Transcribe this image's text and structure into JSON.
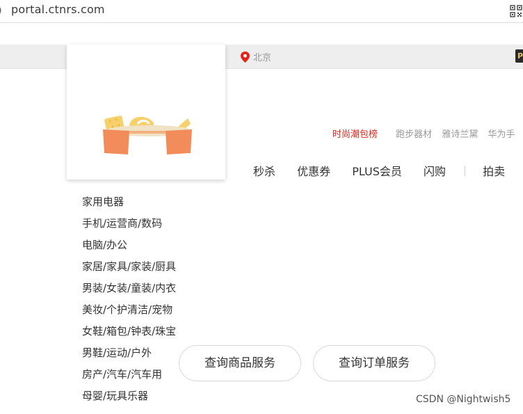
{
  "browser": {
    "url": "portal.ctnrs.com",
    "icons": [
      "page-info-icon",
      "qr-code-icon"
    ]
  },
  "topbar": {
    "location": "北京",
    "location_icon": "location-pin-icon",
    "plus_badge": "P"
  },
  "hot_words": [
    "时尚潮包榜",
    "跑步器材",
    "雅诗兰黛",
    "华为手"
  ],
  "nav_menu": [
    "秒杀",
    "优惠券",
    "PLUS会员",
    "闪购",
    "拍卖"
  ],
  "categories": [
    "家用电器",
    "手机/运营商/数码",
    "电脑/办公",
    "家居/家具/家装/厨具",
    "男装/女装/童装/内衣",
    "美妆/个护清洁/宠物",
    "女鞋/箱包/钟表/珠宝",
    "男鞋/运动/户外",
    "房产/汽车/汽车用",
    "母婴/玩具乐器"
  ],
  "buttons": {
    "query_goods": "查询商品服务",
    "query_order": "查询订单服务"
  },
  "watermark": "CSDN @Nightwish5",
  "colors": {
    "accent_red": "#e1251b",
    "logo_orange": "#f28c5a",
    "logo_yellow": "#f6d16b"
  }
}
